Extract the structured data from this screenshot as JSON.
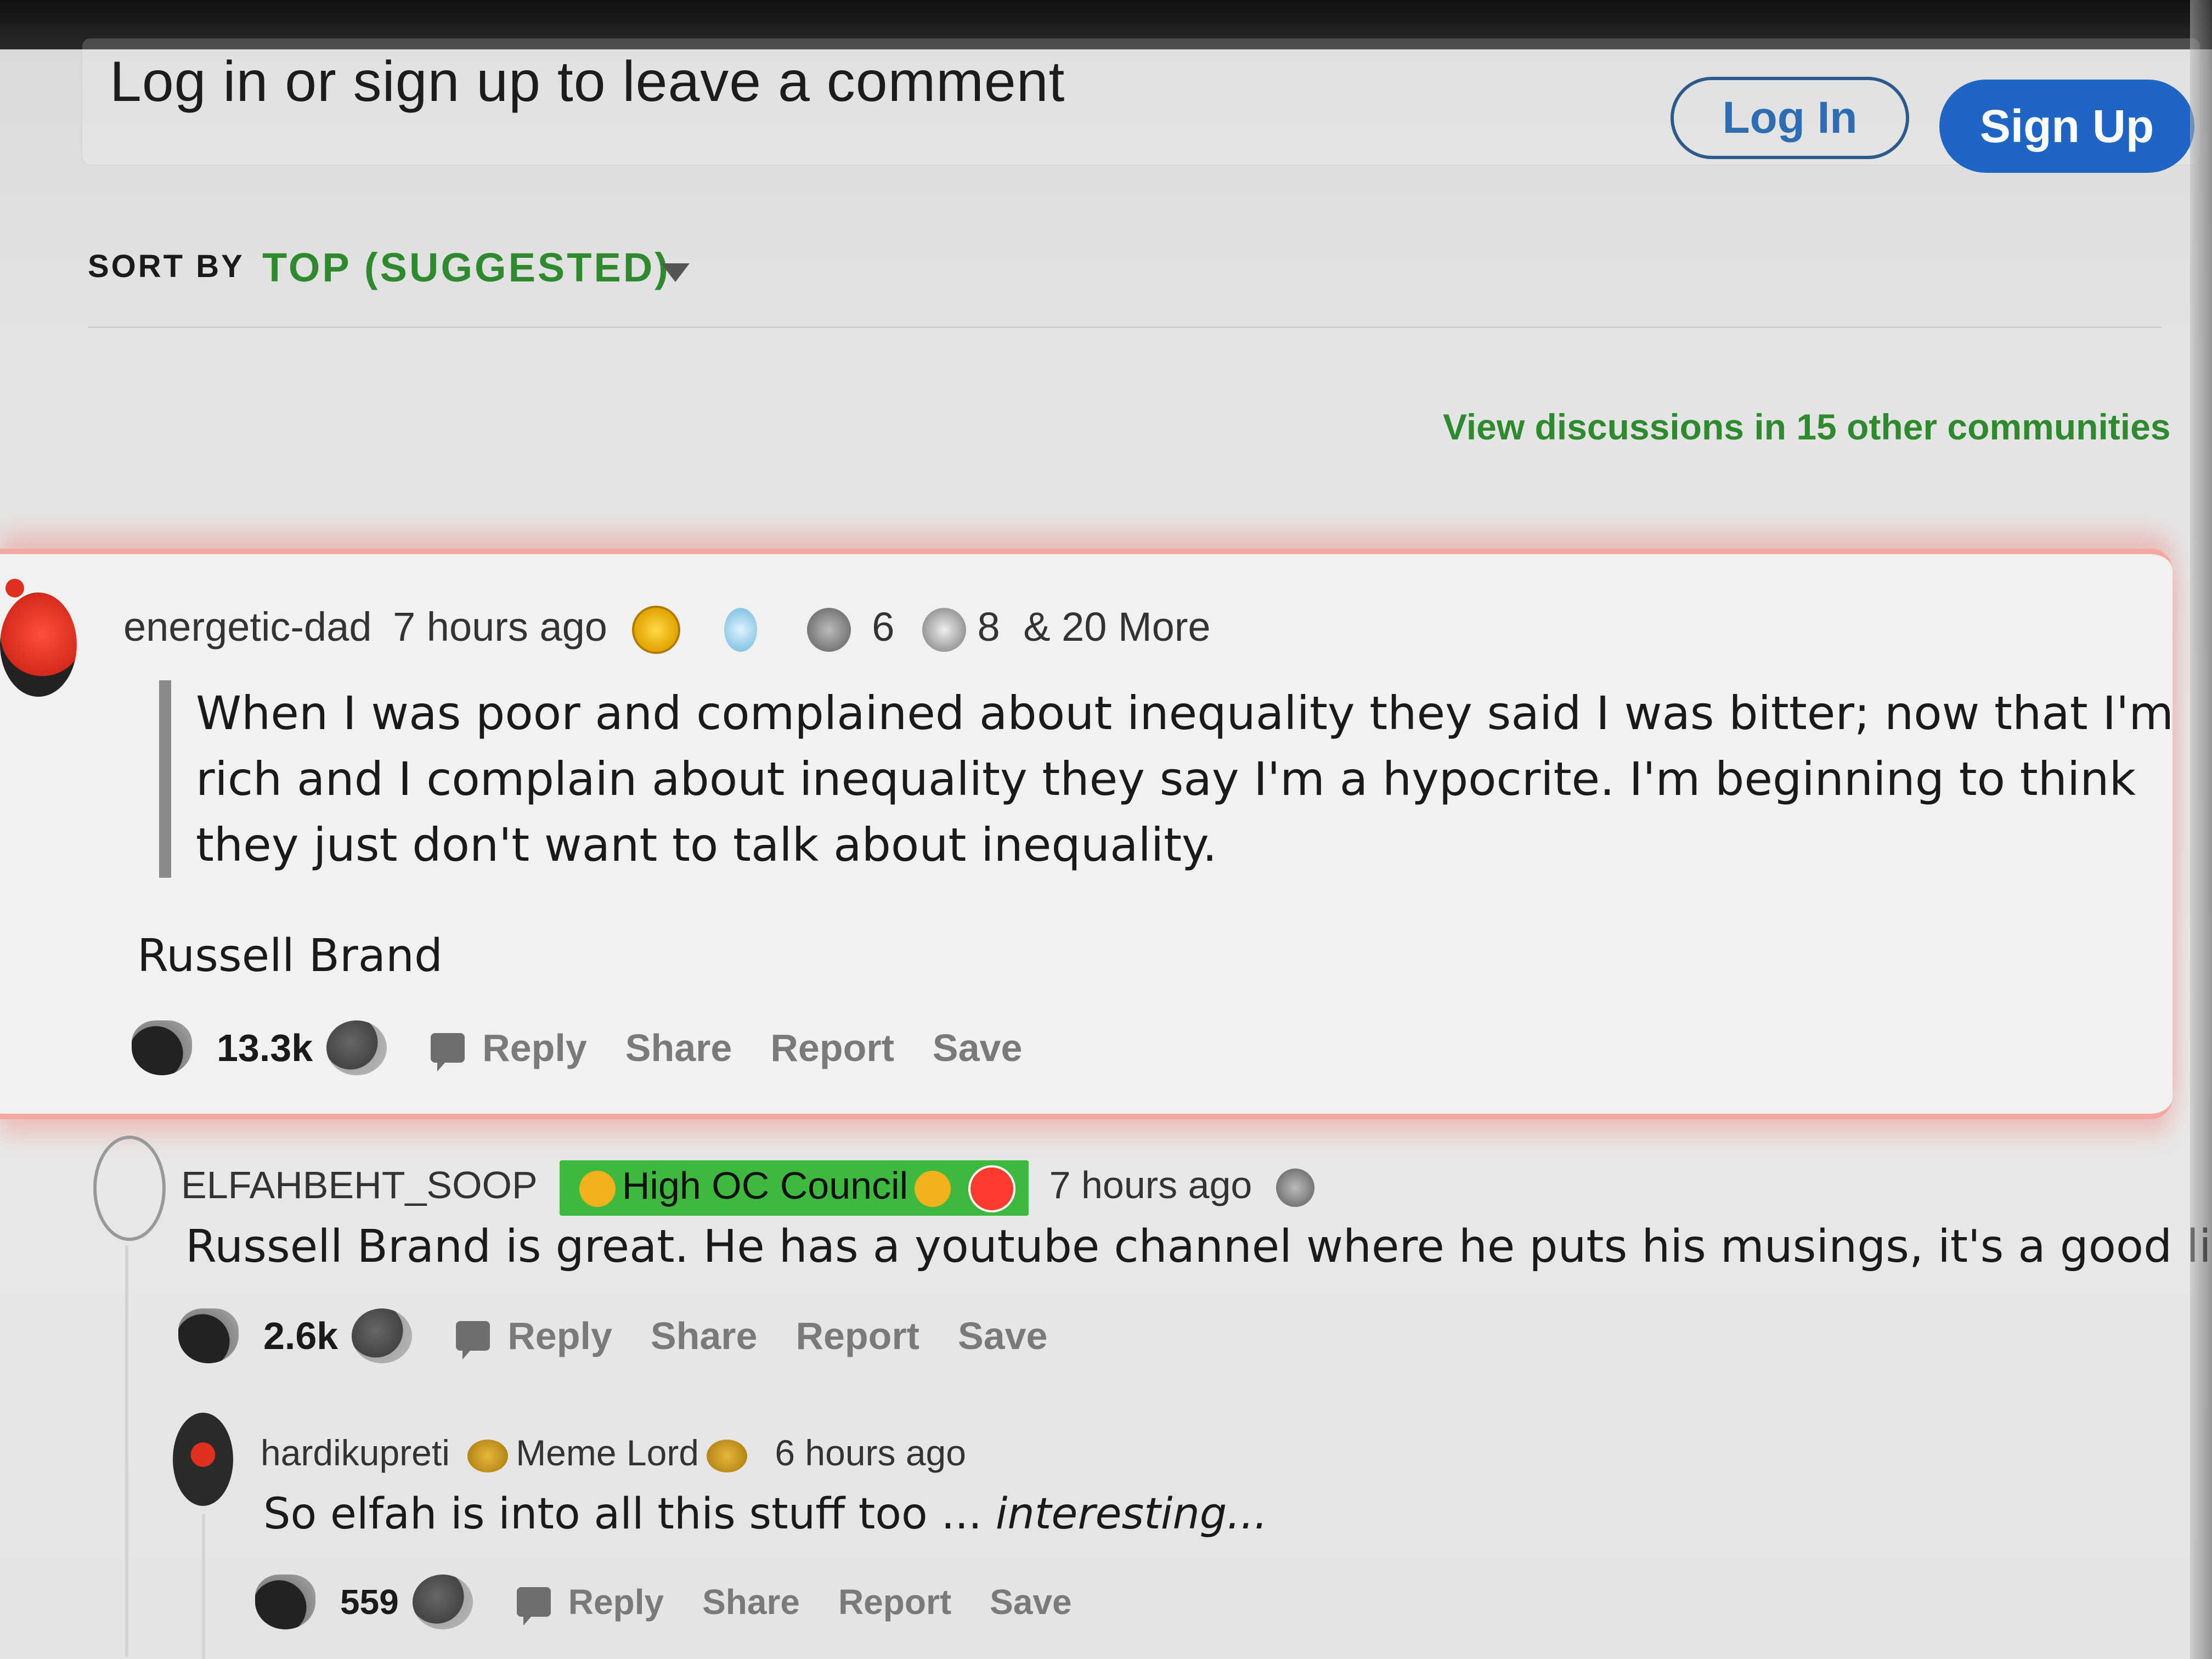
{
  "login": {
    "prompt": "Log in or sign up to leave a comment",
    "login_label": "Log In",
    "signup_label": "Sign Up"
  },
  "sort": {
    "label": "SORT BY",
    "value": "TOP (SUGGESTED)"
  },
  "view_discussions": "View discussions in 15 other communities",
  "colors": {
    "accent_green": "#2f8a2f",
    "signup_blue": "#1f66c4",
    "highlight_pink": "#f3a9a2",
    "flair_green": "#3fb83f"
  },
  "comments": [
    {
      "author": "energetic-dad",
      "time": "7 hours ago",
      "awards": {
        "count_a": "6",
        "count_b": "8",
        "more": "& 20 More",
        "icons": [
          "gold-award-icon",
          "lightbulb-award-icon",
          "ally-award-icon",
          "wave-award-icon"
        ]
      },
      "quote": "When I was poor and complained about inequality they said I was bitter; now that I'm rich and I complain about inequality they say I'm a hypocrite. I'm beginning to think they just don't want to talk about inequality.",
      "attribution": "Russell Brand",
      "votes": "13.3k",
      "actions": [
        "Reply",
        "Share",
        "Report",
        "Save"
      ]
    },
    {
      "author": "ELFAHBEHT_SOOP",
      "flair": "High OC Council",
      "time": "7 hours ago",
      "body": "Russell Brand is great. He has a youtube channel where he puts his musings, it's a good listen.",
      "votes": "2.6k",
      "actions": [
        "Reply",
        "Share",
        "Report",
        "Save"
      ]
    },
    {
      "author": "hardikupreti",
      "flair": "Meme Lord",
      "time": "6 hours ago",
      "body_plain": "So elfah is into all this stuff too ... ",
      "body_italic": "interesting...",
      "votes": "559",
      "actions": [
        "Reply",
        "Share",
        "Report",
        "Save"
      ]
    }
  ]
}
